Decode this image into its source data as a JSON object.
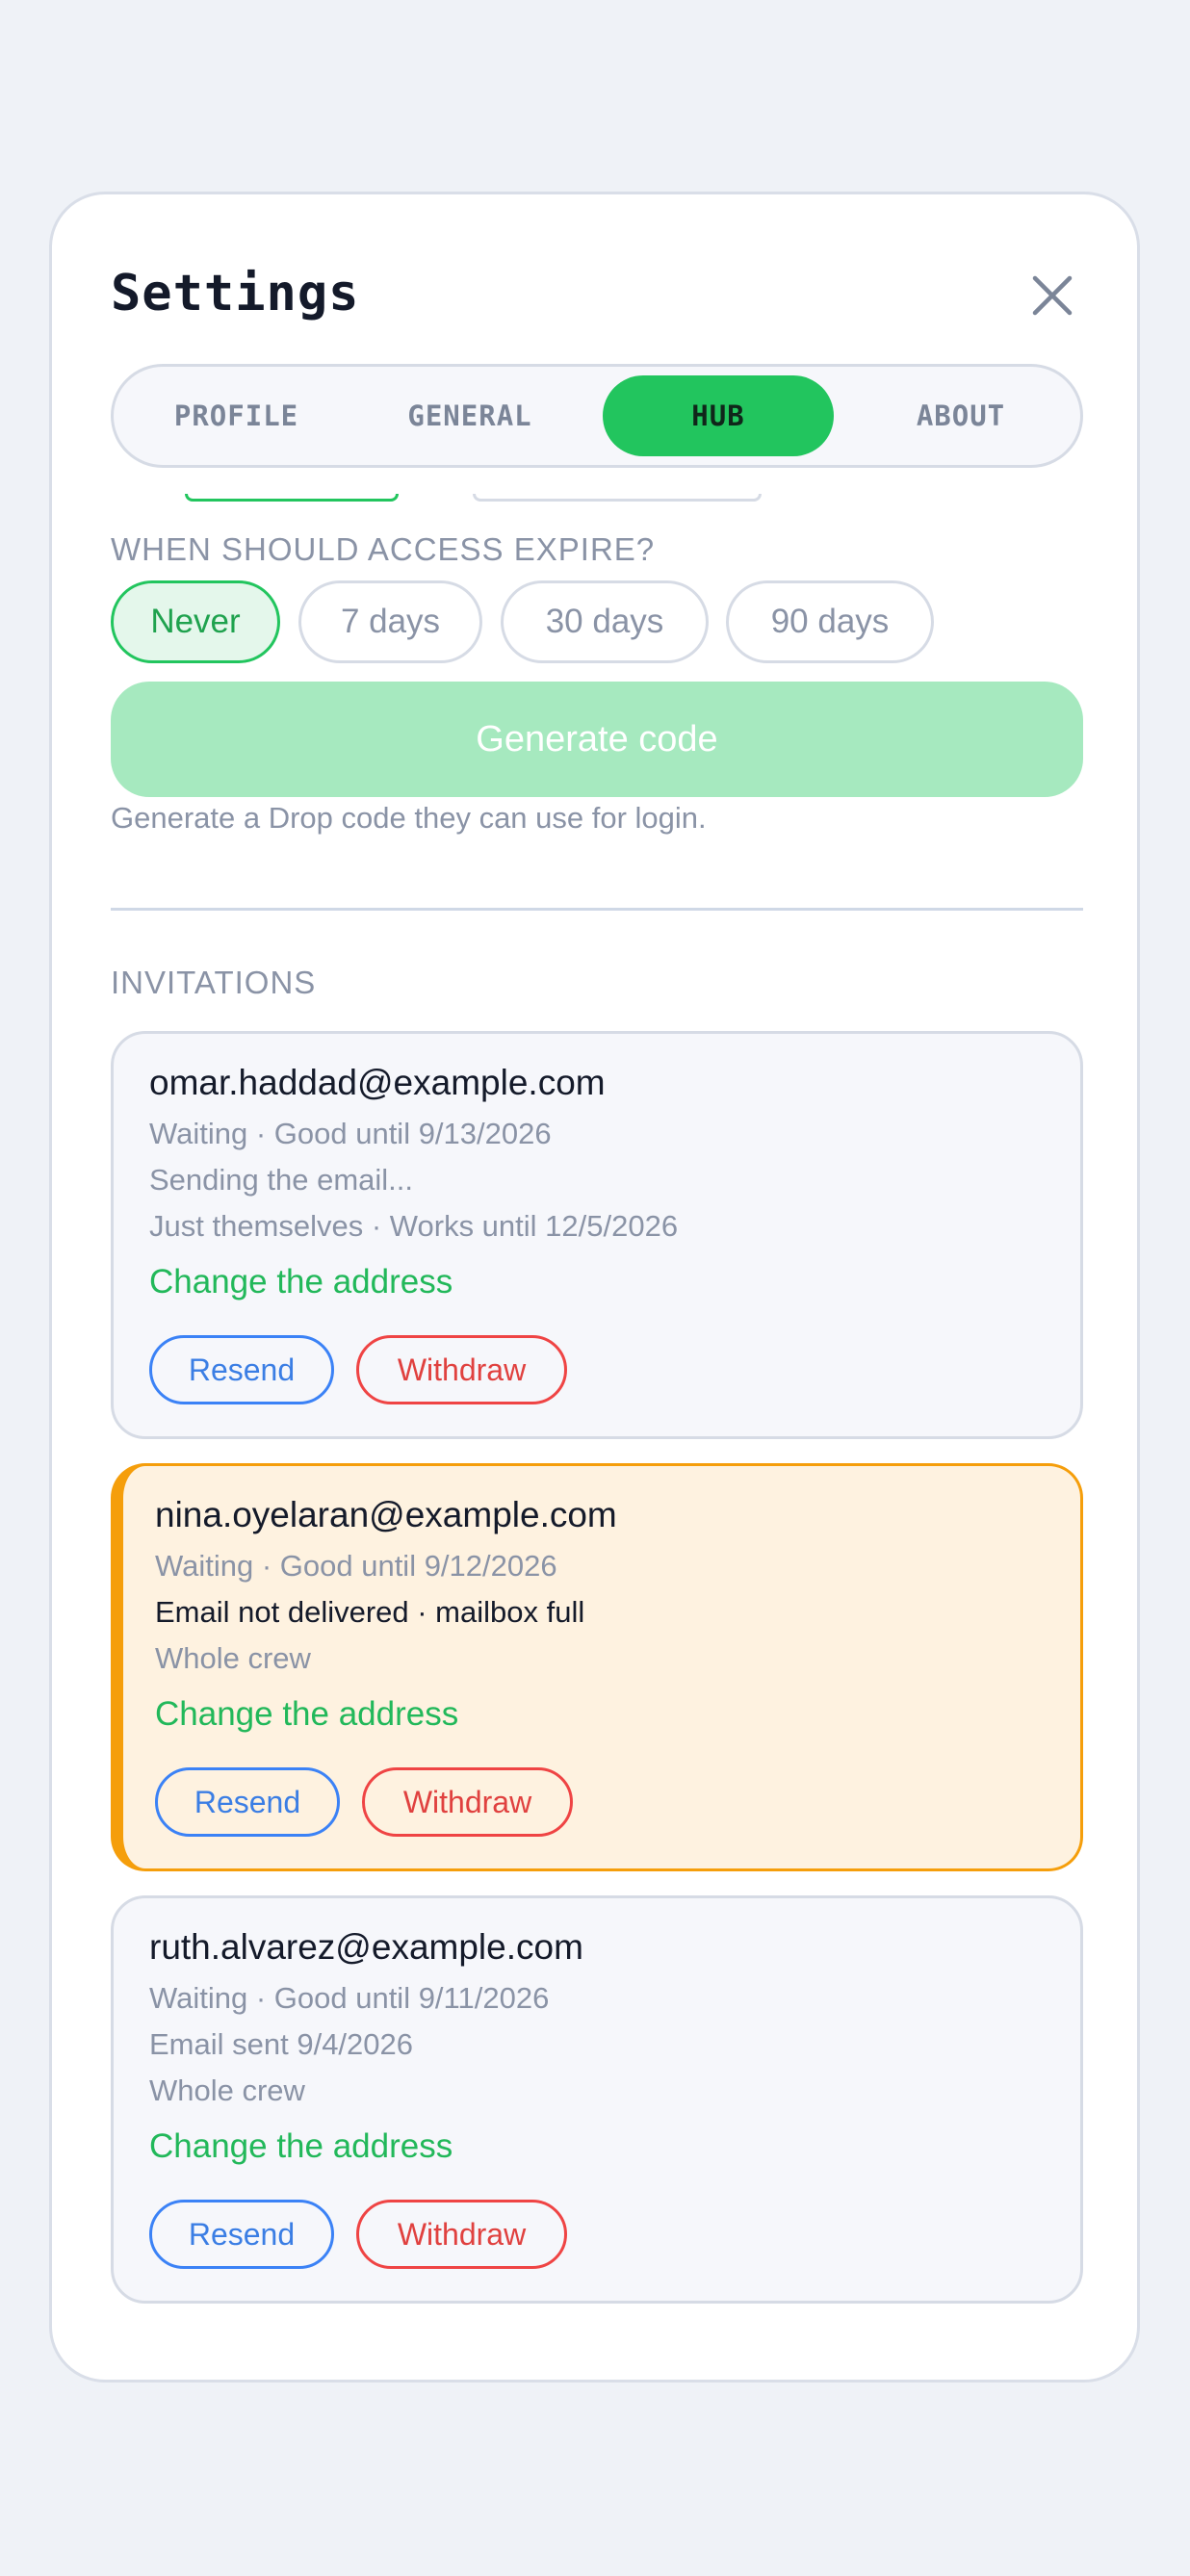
{
  "settings": {
    "title": "Settings",
    "close_icon": "close-icon"
  },
  "tabs": [
    {
      "label": "PROFILE",
      "active": false
    },
    {
      "label": "GENERAL",
      "active": false
    },
    {
      "label": "HUB",
      "active": true
    },
    {
      "label": "ABOUT",
      "active": false
    }
  ],
  "access": {
    "label": "WHEN SHOULD ACCESS EXPIRE?",
    "options": [
      "Never",
      "7 days",
      "30 days",
      "90 days"
    ],
    "selected": "Never",
    "generate_label": "Generate code",
    "helper": "Generate a Drop code they can use for login."
  },
  "invitations": {
    "label": "INVITATIONS",
    "items": [
      {
        "email": "omar.haddad@example.com",
        "status": "Waiting · Good until 9/13/2026",
        "delivery": "Sending the email...",
        "scope": "Just themselves · Works until 12/5/2026",
        "change_label": "Change the address",
        "resend_label": "Resend",
        "withdraw_label": "Withdraw",
        "warning": false
      },
      {
        "email": "nina.oyelaran@example.com",
        "status": "Waiting · Good until 9/12/2026",
        "delivery": "Email not delivered · mailbox full",
        "scope": "Whole crew",
        "change_label": "Change the address",
        "resend_label": "Resend",
        "withdraw_label": "Withdraw",
        "warning": true
      },
      {
        "email": "ruth.alvarez@example.com",
        "status": "Waiting · Good until 9/11/2026",
        "delivery": "Email sent 9/4/2026",
        "scope": "Whole crew",
        "change_label": "Change the address",
        "resend_label": "Resend",
        "withdraw_label": "Withdraw",
        "warning": false
      }
    ]
  },
  "colors": {
    "accent_green": "#22c55e",
    "warning_orange": "#f59e0b",
    "resend_blue": "#3b82f6",
    "withdraw_red": "#ef4444"
  }
}
